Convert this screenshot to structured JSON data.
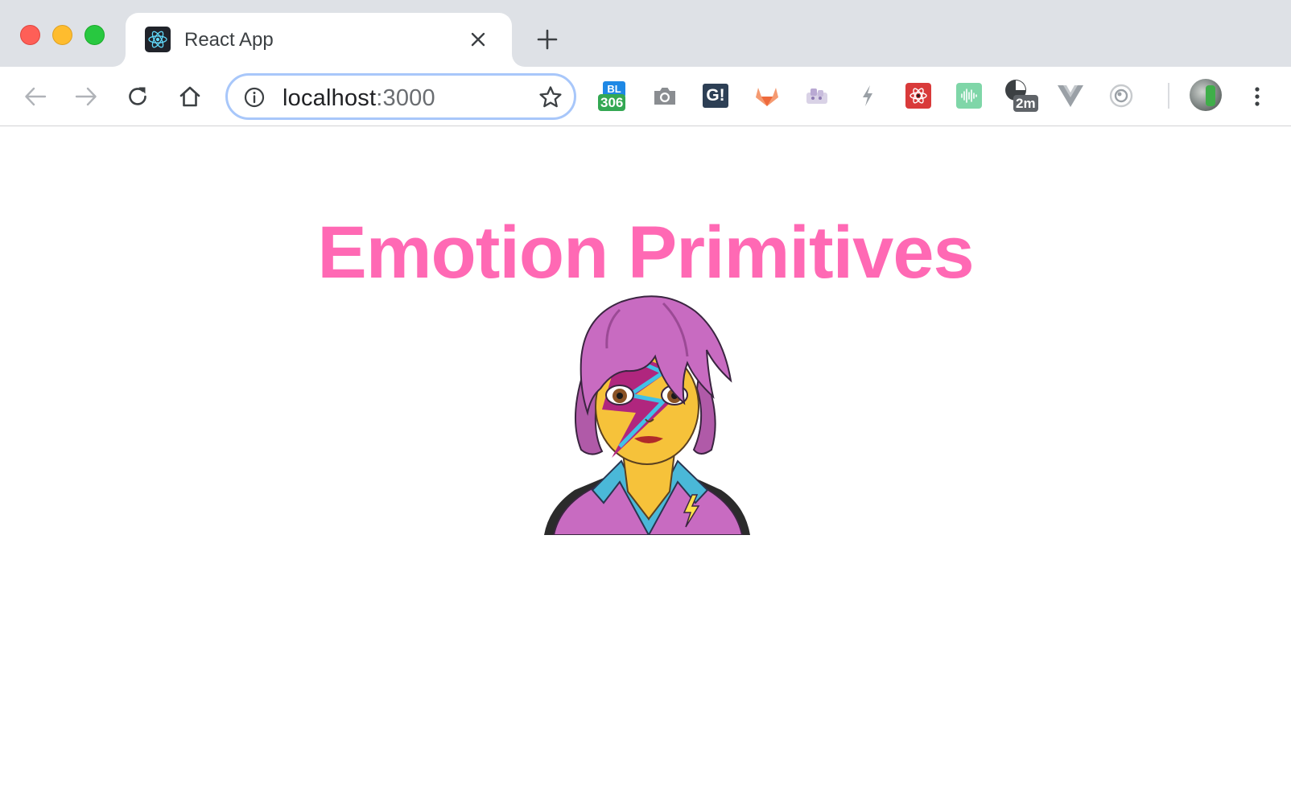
{
  "browser": {
    "tab": {
      "title": "React App",
      "favicon": "react-logo-icon"
    },
    "address": {
      "host": "localhost",
      "port": ":3000"
    },
    "extensions": [
      {
        "name": "bl-extension-icon",
        "badge": "306",
        "label": "BL",
        "badge_color": "#34a853"
      },
      {
        "name": "camera-icon"
      },
      {
        "name": "grammarly-style-icon",
        "label": "G!"
      },
      {
        "name": "gitlab-icon"
      },
      {
        "name": "keys-icon"
      },
      {
        "name": "lightning-icon"
      },
      {
        "name": "react-devtools-icon"
      },
      {
        "name": "audio-wave-icon"
      },
      {
        "name": "timer-icon",
        "badge": "2m",
        "badge_color": "#5f6368"
      },
      {
        "name": "vue-devtools-icon"
      },
      {
        "name": "target-icon"
      }
    ]
  },
  "page": {
    "heading": "Emotion Primitives",
    "heading_color": "#ff69b4",
    "image": "singer-emoji-illustration"
  }
}
